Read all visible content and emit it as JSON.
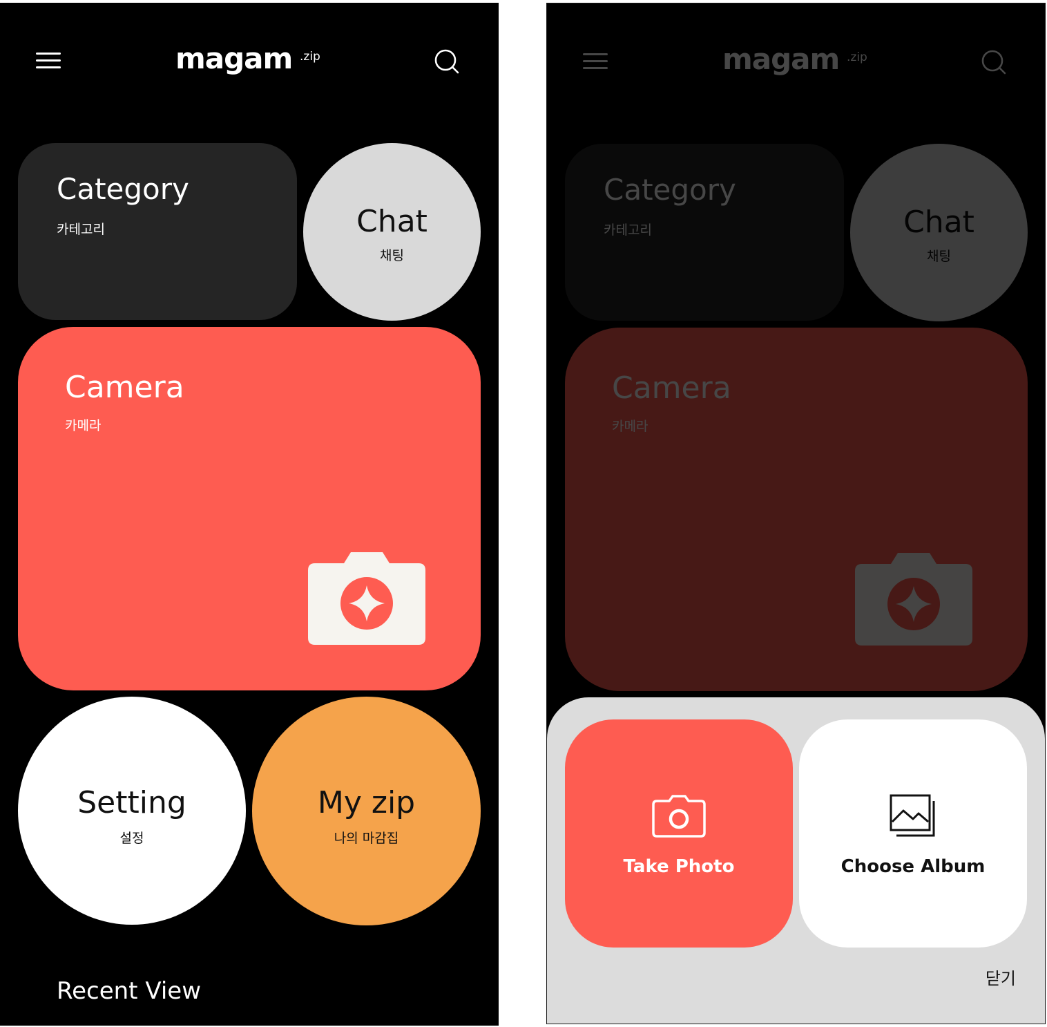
{
  "app": {
    "logo_main": "magam",
    "logo_suffix": ".zip"
  },
  "home": {
    "category": {
      "title": "Category",
      "subtitle": "카테고리"
    },
    "chat": {
      "title": "Chat",
      "subtitle": "채팅"
    },
    "camera": {
      "title": "Camera",
      "subtitle": "카메라"
    },
    "setting": {
      "title": "Setting",
      "subtitle": "설정"
    },
    "myzip": {
      "title": "My zip",
      "subtitle": "나의 마감집"
    },
    "recent_view": "Recent View"
  },
  "camera_sheet": {
    "take_photo": "Take Photo",
    "choose_album": "Choose Album",
    "close": "닫기"
  },
  "icons": {
    "menu": "hamburger-menu-icon",
    "search": "search-icon",
    "camera": "camera-icon",
    "album": "album-icon"
  },
  "colors": {
    "background": "#000000",
    "category_card": "#252525",
    "chat_card": "#d9d9d9",
    "camera_card": "#fe5c51",
    "setting_card": "#ffffff",
    "myzip_card": "#f5a34b",
    "sheet_background": "#dcdcdc"
  }
}
